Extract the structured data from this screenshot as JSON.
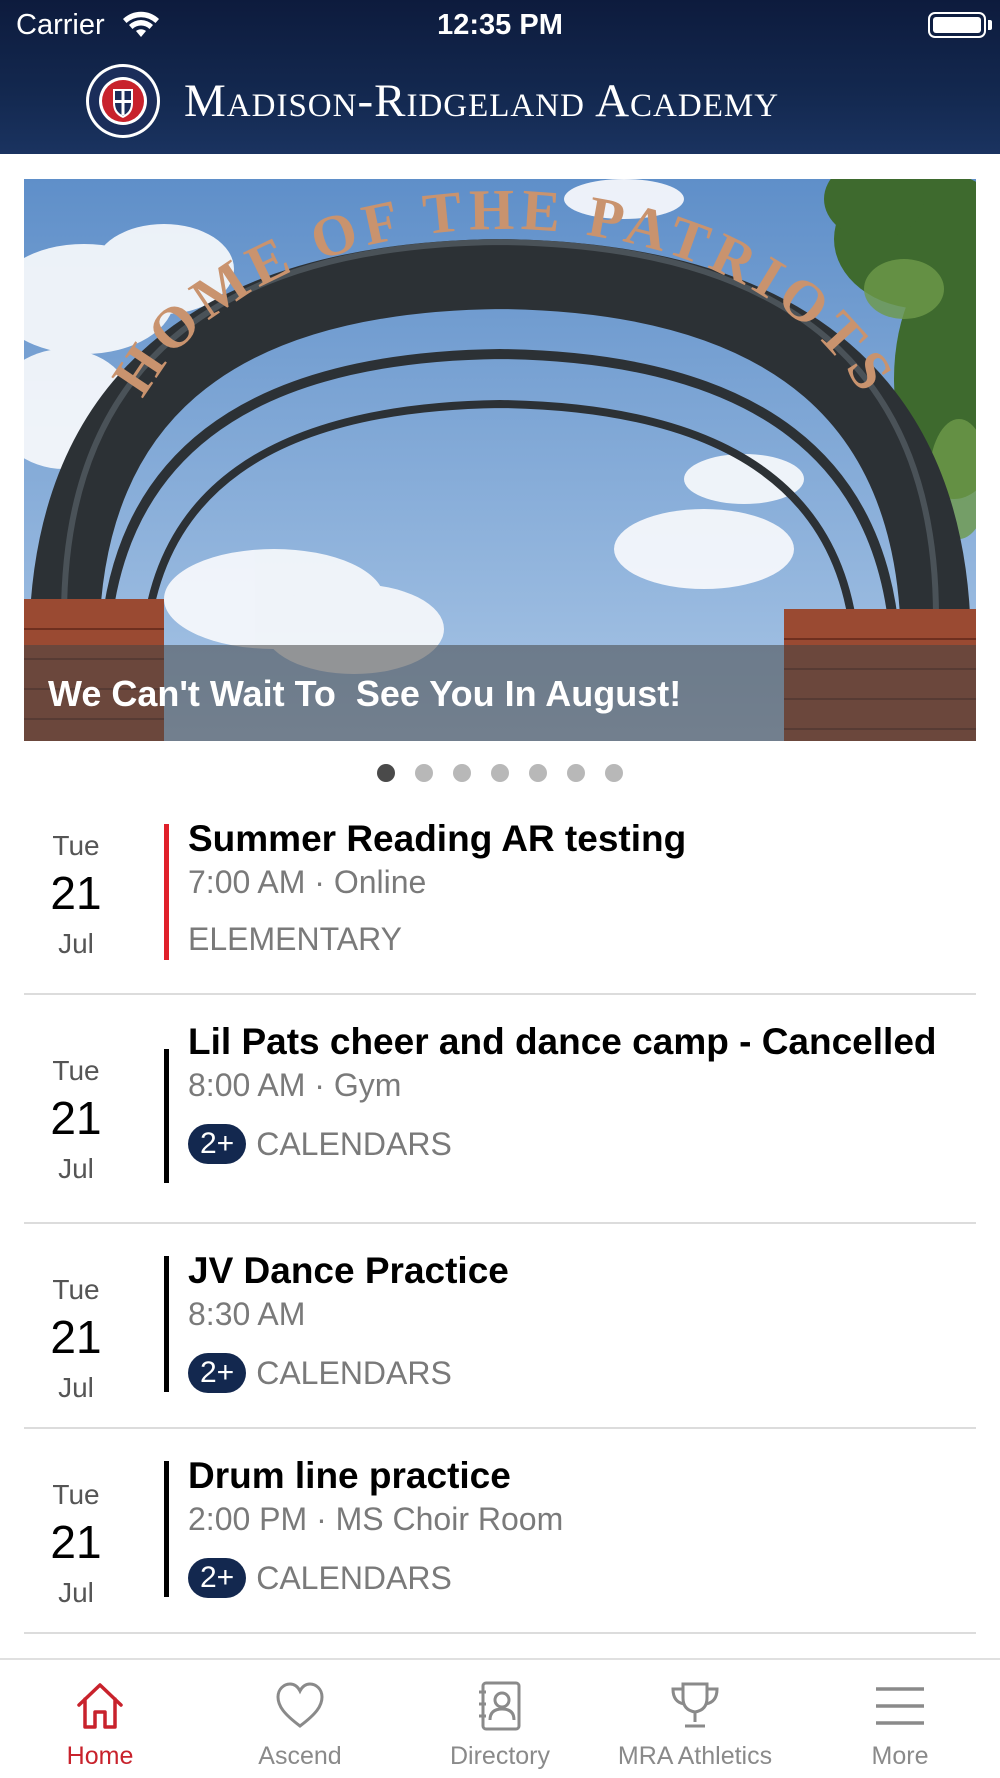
{
  "status_bar": {
    "carrier": "Carrier",
    "time": "12:35 PM"
  },
  "header": {
    "school_name": "Madison-Ridgeland Academy",
    "logo_text": "Madison-Ridgeland Academy Established 1969"
  },
  "carousel": {
    "caption": "We Can't Wait To  See You In August!",
    "slide_count": 7,
    "active_index": 0,
    "arch_text": "HOME OF THE PATRIOTS"
  },
  "events": [
    {
      "dow": "Tue",
      "day": "21",
      "month": "Jul",
      "title": "Summer Reading AR testing",
      "meta": "7:00 AM · Online",
      "calendar": "ELEMENTARY",
      "badge": "",
      "bar_color": "#e0202a"
    },
    {
      "dow": "Tue",
      "day": "21",
      "month": "Jul",
      "title": "Lil Pats cheer and dance camp - Cancelled",
      "meta": "8:00 AM · Gym",
      "calendar": "CALENDARS",
      "badge": "2+",
      "bar_color": "#000000"
    },
    {
      "dow": "Tue",
      "day": "21",
      "month": "Jul",
      "title": "JV Dance Practice",
      "meta": "8:30 AM",
      "calendar": "CALENDARS",
      "badge": "2+",
      "bar_color": "#000000"
    },
    {
      "dow": "Tue",
      "day": "21",
      "month": "Jul",
      "title": "Drum line practice",
      "meta": "2:00 PM · MS Choir Room",
      "calendar": "CALENDARS",
      "badge": "2+",
      "bar_color": "#000000"
    }
  ],
  "tabs": [
    {
      "label": "Home",
      "icon": "home-icon",
      "active": true
    },
    {
      "label": "Ascend",
      "icon": "heart-icon",
      "active": false
    },
    {
      "label": "Directory",
      "icon": "contacts-icon",
      "active": false
    },
    {
      "label": "MRA Athletics",
      "icon": "trophy-icon",
      "active": false
    },
    {
      "label": "More",
      "icon": "menu-icon",
      "active": false
    }
  ],
  "colors": {
    "header": "#13284f",
    "accent_red": "#c8222c",
    "badge": "#13284f"
  }
}
